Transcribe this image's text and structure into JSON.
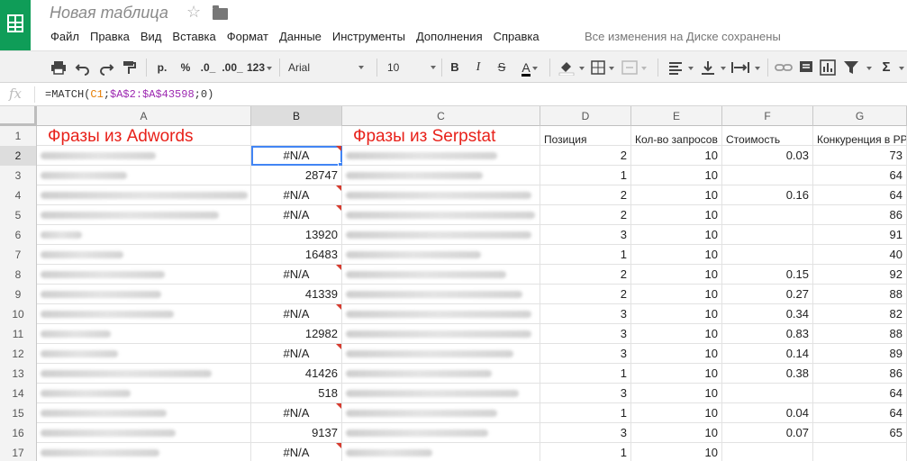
{
  "app": {
    "title": "Новая таблица",
    "save_status": "Все изменения на Диске сохранены"
  },
  "menu": [
    "Файл",
    "Правка",
    "Вид",
    "Вставка",
    "Формат",
    "Данные",
    "Инструменты",
    "Дополнения",
    "Справка"
  ],
  "toolbar": {
    "print_icon": "printer-icon",
    "undo_icon": "undo-icon",
    "redo_icon": "redo-icon",
    "paint_format_icon": "paint-format-icon",
    "currency": "р.",
    "percent": "%",
    "decrease_decimals": ".0_",
    "increase_decimals": ".00_",
    "more_formats": "123",
    "font": "Arial",
    "font_size": "10",
    "bold": "B",
    "italic": "I",
    "strikethrough": "S",
    "text_color": "A",
    "functions": "Σ"
  },
  "formula_bar": {
    "fx_label": "fx",
    "part1": "=MATCH(",
    "ref1": "C1",
    "sep1": ";",
    "ref2": "$A$2:$A$43598",
    "sep2": ";",
    "arg3": "0",
    "close": ")"
  },
  "columns": [
    "A",
    "B",
    "C",
    "D",
    "E",
    "F",
    "G"
  ],
  "selected_column": "B",
  "selected_row": "2",
  "header_row": {
    "a": "Фразы из Adwords",
    "c": "Фразы из Serpstat",
    "d": "Позиция",
    "e": "Кол-во запросов",
    "f": "Стоимость",
    "g": "Конкуренция в РРС"
  },
  "rows": [
    {
      "n": "2",
      "b": "#N/A",
      "d": "2",
      "e": "10",
      "f": "0.03",
      "g": "73"
    },
    {
      "n": "3",
      "b": "28747",
      "d": "1",
      "e": "10",
      "f": "",
      "g": "64"
    },
    {
      "n": "4",
      "b": "#N/A",
      "d": "2",
      "e": "10",
      "f": "0.16",
      "g": "64"
    },
    {
      "n": "5",
      "b": "#N/A",
      "d": "2",
      "e": "10",
      "f": "",
      "g": "86"
    },
    {
      "n": "6",
      "b": "13920",
      "d": "3",
      "e": "10",
      "f": "",
      "g": "91"
    },
    {
      "n": "7",
      "b": "16483",
      "d": "1",
      "e": "10",
      "f": "",
      "g": "40"
    },
    {
      "n": "8",
      "b": "#N/A",
      "d": "2",
      "e": "10",
      "f": "0.15",
      "g": "92"
    },
    {
      "n": "9",
      "b": "41339",
      "d": "2",
      "e": "10",
      "f": "0.27",
      "g": "88"
    },
    {
      "n": "10",
      "b": "#N/A",
      "d": "3",
      "e": "10",
      "f": "0.34",
      "g": "82"
    },
    {
      "n": "11",
      "b": "12982",
      "d": "3",
      "e": "10",
      "f": "0.83",
      "g": "88"
    },
    {
      "n": "12",
      "b": "#N/A",
      "d": "3",
      "e": "10",
      "f": "0.14",
      "g": "89"
    },
    {
      "n": "13",
      "b": "41426",
      "d": "1",
      "e": "10",
      "f": "0.38",
      "g": "86"
    },
    {
      "n": "14",
      "b": "518",
      "d": "3",
      "e": "10",
      "f": "",
      "g": "64"
    },
    {
      "n": "15",
      "b": "#N/A",
      "d": "1",
      "e": "10",
      "f": "0.04",
      "g": "64"
    },
    {
      "n": "16",
      "b": "9137",
      "d": "3",
      "e": "10",
      "f": "0.07",
      "g": "65"
    },
    {
      "n": "17",
      "b": "#N/A",
      "d": "1",
      "e": "10",
      "f": "",
      "g": ""
    }
  ],
  "colors": {
    "brand_green": "#0f9d58",
    "header_red": "#e8211a",
    "selection_blue": "#4285f4",
    "comment_marker": "#d63b2e"
  }
}
